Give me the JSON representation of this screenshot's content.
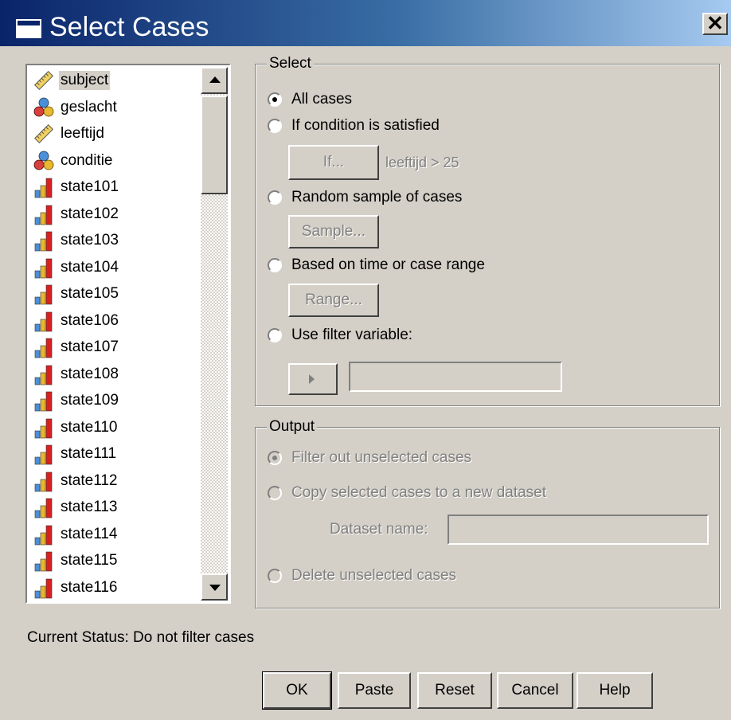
{
  "window": {
    "title": "Select Cases",
    "close_label": "✕"
  },
  "variables": [
    {
      "name": "subject",
      "icon": "scale-ruler-icon",
      "selected": true
    },
    {
      "name": "geslacht",
      "icon": "nominal-balls-icon"
    },
    {
      "name": "leeftijd",
      "icon": "scale-ruler-icon"
    },
    {
      "name": "conditie",
      "icon": "nominal-balls-icon"
    },
    {
      "name": "state101",
      "icon": "ordinal-bars-icon"
    },
    {
      "name": "state102",
      "icon": "ordinal-bars-icon"
    },
    {
      "name": "state103",
      "icon": "ordinal-bars-icon"
    },
    {
      "name": "state104",
      "icon": "ordinal-bars-icon"
    },
    {
      "name": "state105",
      "icon": "ordinal-bars-icon"
    },
    {
      "name": "state106",
      "icon": "ordinal-bars-icon"
    },
    {
      "name": "state107",
      "icon": "ordinal-bars-icon"
    },
    {
      "name": "state108",
      "icon": "ordinal-bars-icon"
    },
    {
      "name": "state109",
      "icon": "ordinal-bars-icon"
    },
    {
      "name": "state110",
      "icon": "ordinal-bars-icon"
    },
    {
      "name": "state111",
      "icon": "ordinal-bars-icon"
    },
    {
      "name": "state112",
      "icon": "ordinal-bars-icon"
    },
    {
      "name": "state113",
      "icon": "ordinal-bars-icon"
    },
    {
      "name": "state114",
      "icon": "ordinal-bars-icon"
    },
    {
      "name": "state115",
      "icon": "ordinal-bars-icon"
    },
    {
      "name": "state116",
      "icon": "ordinal-bars-icon"
    }
  ],
  "select_group": {
    "legend": "Select",
    "all_cases": "All cases",
    "if_condition": "If condition is satisfied",
    "if_button": "If...",
    "condition_text": "leeftijd > 25",
    "random_sample": "Random sample of cases",
    "sample_button": "Sample...",
    "time_range": "Based on time or case range",
    "range_button": "Range...",
    "filter_variable": "Use filter variable:",
    "selected_option": "all_cases"
  },
  "output_group": {
    "legend": "Output",
    "filter_out": "Filter out unselected cases",
    "copy_selected": "Copy selected cases to a new dataset",
    "dataset_name_label": "Dataset name:",
    "delete_unselected": "Delete unselected cases",
    "selected_option": "filter_out"
  },
  "status": "Current Status: Do not filter cases",
  "buttons": {
    "ok": "OK",
    "paste": "Paste",
    "reset": "Reset",
    "cancel": "Cancel",
    "help": "Help"
  },
  "colors": {
    "dialog_bg": "#d4d0c8",
    "title_start": "#0a246a",
    "title_end": "#a6caf0"
  }
}
